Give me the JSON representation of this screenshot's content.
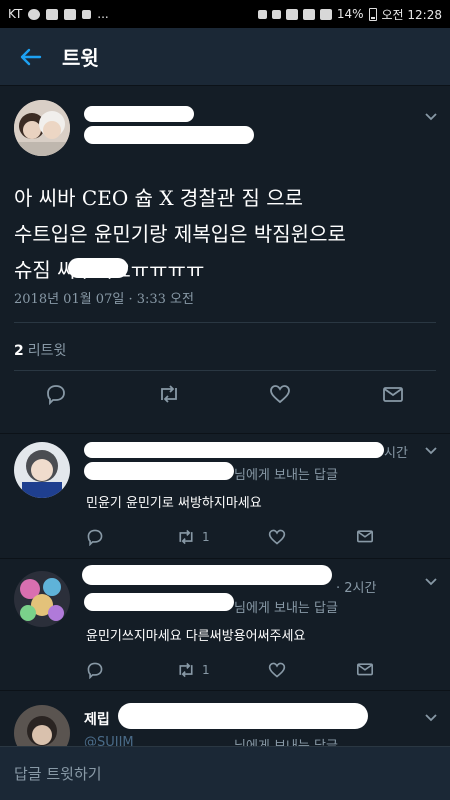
{
  "status_bar": {
    "carrier": "KT",
    "more": "...",
    "battery": "14%",
    "time": "오전 12:28"
  },
  "app_bar": {
    "title": "트윗"
  },
  "tweet": {
    "text_lines": [
      "아 씨바 CEO 슙 X 경찰관 짐 으로",
      "수트입은 윤민기랑 제복입은 박짐윈으로",
      "슈짐       써주세요ㅠㅠㅠㅠ"
    ],
    "datetime": "2018년 01월 07일 · 3:33 오전",
    "retweet_count": "2",
    "retweet_label": "리트윗"
  },
  "replies": [
    {
      "time_suffix": "시간",
      "reply_to": "님에게 보내는 답글",
      "text": "민윤기 윤민기로 써방하지마세요",
      "retweets": "1"
    },
    {
      "name_suffix": "· 2시간",
      "reply_to": "님에게 보내는 답글",
      "text": "윤민기쓰지마세요 다른써방용어써주세요",
      "retweets": "1"
    },
    {
      "name_prefix": "제립",
      "handle_prefix": "@SUJIM",
      "reply_to": "님에게 보내는 답글"
    }
  ],
  "composer": {
    "placeholder": "답글 트윗하기"
  },
  "colors": {
    "background": "#10171e",
    "card": "#141d26",
    "app_bar": "#1b2836",
    "accent": "#1da1f2",
    "muted": "#8899a6"
  }
}
